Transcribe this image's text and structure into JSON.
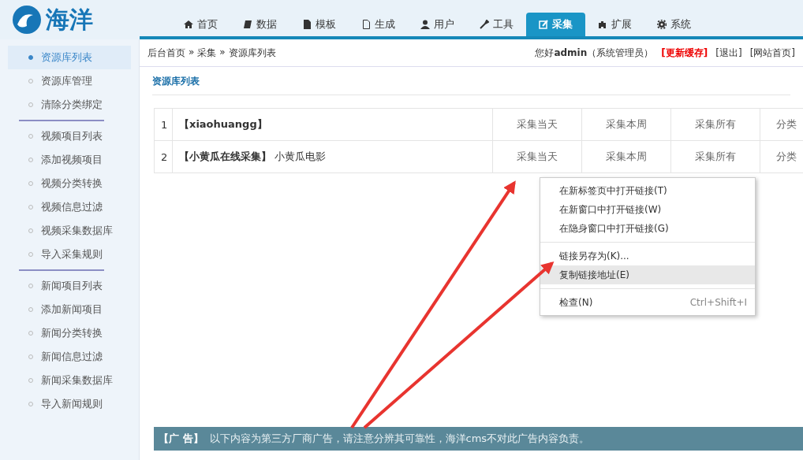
{
  "logo": {
    "text": "海洋"
  },
  "nav": [
    {
      "label": "首页",
      "selected": false
    },
    {
      "label": "数据",
      "selected": false
    },
    {
      "label": "模板",
      "selected": false
    },
    {
      "label": "生成",
      "selected": false
    },
    {
      "label": "用户",
      "selected": false
    },
    {
      "label": "工具",
      "selected": false
    },
    {
      "label": "采集",
      "selected": true
    },
    {
      "label": "扩展",
      "selected": false
    },
    {
      "label": "系统",
      "selected": false
    }
  ],
  "breadcrumb": [
    "后台首页",
    "采集",
    "资源库列表"
  ],
  "breadcrumb_separator": "»",
  "user_bar": {
    "greeting": "您好**admin**（系统管理员）",
    "links": [
      {
        "label": "[更新缓存]",
        "kind": "alert"
      },
      {
        "label": "[退出]",
        "kind": "plain"
      },
      {
        "label": "[网站首页]",
        "kind": "plain"
      }
    ]
  },
  "sidebar": {
    "groups": [
      {
        "items": [
          {
            "label": "资源库列表",
            "selected": true
          },
          {
            "label": "资源库管理",
            "selected": false
          },
          {
            "label": "清除分类绑定",
            "selected": false
          }
        ]
      },
      {
        "items": [
          {
            "label": "视频项目列表",
            "selected": false
          },
          {
            "label": "添加视频项目",
            "selected": false
          },
          {
            "label": "视频分类转换",
            "selected": false
          },
          {
            "label": "视频信息过滤",
            "selected": false
          },
          {
            "label": "视频采集数据库",
            "selected": false
          },
          {
            "label": "导入采集规则",
            "selected": false
          }
        ]
      },
      {
        "items": [
          {
            "label": "新闻项目列表",
            "selected": false
          },
          {
            "label": "添加新闻项目",
            "selected": false
          },
          {
            "label": "新闻分类转换",
            "selected": false
          },
          {
            "label": "新闻信息过滤",
            "selected": false
          },
          {
            "label": "新闻采集数据库",
            "selected": false
          },
          {
            "label": "导入新闻规则",
            "selected": false
          }
        ]
      }
    ]
  },
  "page_title": "资源库列表",
  "table": {
    "rows": [
      {
        "index": "1",
        "name": "【xiaohuangg】",
        "note": "",
        "actions": [
          "采集当天",
          "采集本周",
          "采集所有",
          "分类"
        ]
      },
      {
        "index": "2",
        "name": "【小黄瓜在线采集】",
        "note": "小黄瓜电影",
        "actions": [
          "采集当天",
          "采集本周",
          "采集所有",
          "分类"
        ]
      }
    ]
  },
  "context_menu": {
    "groups": [
      [
        {
          "label": "在新标签页中打开链接(T)",
          "selected": false
        },
        {
          "label": "在新窗口中打开链接(W)",
          "selected": false
        },
        {
          "label": "在隐身窗口中打开链接(G)",
          "selected": false
        }
      ],
      [
        {
          "label": "链接另存为(K)...",
          "selected": false
        },
        {
          "label": "复制链接地址(E)",
          "selected": true
        }
      ],
      [
        {
          "label": "检查(N)",
          "shortcut": "Ctrl+Shift+I",
          "selected": false
        }
      ]
    ]
  },
  "ad_banner": {
    "tag": "【广 告】",
    "text": "以下内容为第三方厂商广告，请注意分辨其可靠性，海洋cms不对此广告内容负责。"
  }
}
